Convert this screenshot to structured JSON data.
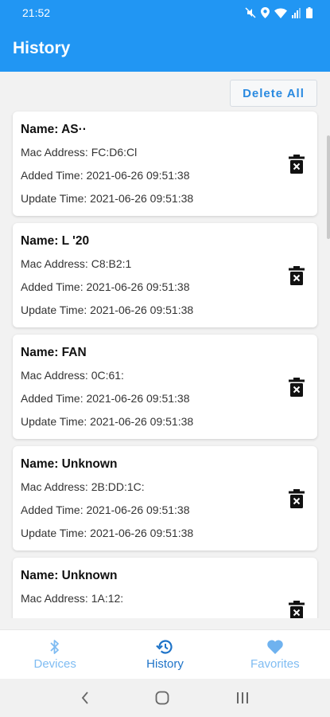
{
  "status_bar": {
    "time": "21:52"
  },
  "app_bar": {
    "title": "History"
  },
  "toolbar": {
    "delete_all_label": "Delete All"
  },
  "devices": [
    {
      "name": "Name: AS··",
      "mac": "Mac Address: FC:D6:Cl",
      "added": "Added Time: 2021-06-26 09:51:38",
      "updated": "Update Time: 2021-06-26 09:51:38"
    },
    {
      "name": "Name: L  '20",
      "mac": "Mac Address: C8:B2:1",
      "added": "Added Time: 2021-06-26 09:51:38",
      "updated": "Update Time: 2021-06-26 09:51:38"
    },
    {
      "name": "Name: FAN",
      "mac": "Mac Address: 0C:61:",
      "added": "Added Time: 2021-06-26 09:51:38",
      "updated": "Update Time: 2021-06-26 09:51:38"
    },
    {
      "name": "Name: Unknown",
      "mac": "Mac Address: 2B:DD:1C:",
      "added": "Added Time: 2021-06-26 09:51:38",
      "updated": "Update Time: 2021-06-26 09:51:38"
    },
    {
      "name": "Name: Unknown",
      "mac": "Mac Address: 1A:12:",
      "added": "",
      "updated": ""
    }
  ],
  "bottom_nav": [
    {
      "label": "Devices",
      "icon": "bluetooth-icon",
      "active": false
    },
    {
      "label": "History",
      "icon": "history-icon",
      "active": true
    },
    {
      "label": "Favorites",
      "icon": "heart-icon",
      "active": false
    }
  ],
  "colors": {
    "primary": "#2196f3",
    "active_tab": "#1e73c8",
    "inactive_tab": "#7fbcf2"
  }
}
